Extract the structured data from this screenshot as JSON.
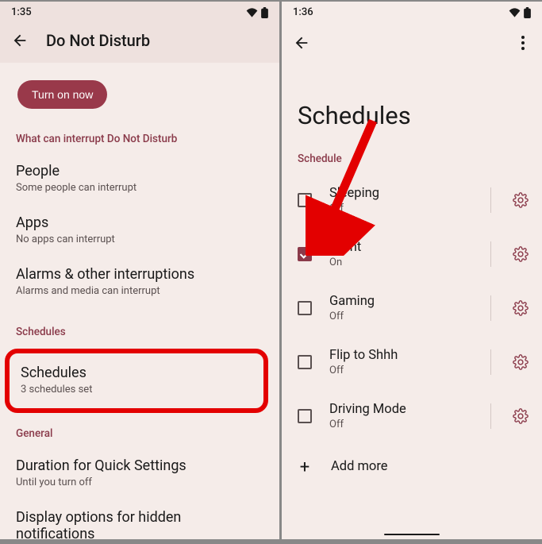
{
  "left": {
    "status_time": "1:35",
    "title": "Do Not Disturb",
    "turn_on_btn": "Turn on now",
    "section_interrupt": "What can interrupt Do Not Disturb",
    "people": {
      "title": "People",
      "sub": "Some people can interrupt"
    },
    "apps": {
      "title": "Apps",
      "sub": "No apps can interrupt"
    },
    "alarms": {
      "title": "Alarms & other interruptions",
      "sub": "Alarms and media can interrupt"
    },
    "section_schedules": "Schedules",
    "schedules": {
      "title": "Schedules",
      "sub": "3 schedules set"
    },
    "section_general": "General",
    "duration": {
      "title": "Duration for Quick Settings",
      "sub": "Until you turn off"
    },
    "display_opts": {
      "title": "Display options for hidden notifications"
    }
  },
  "right": {
    "status_time": "1:36",
    "big_title": "Schedules",
    "section_schedule": "Schedule",
    "items": [
      {
        "title": "Sleeping",
        "sub": "Off",
        "checked": false
      },
      {
        "title": "Event",
        "sub": "On",
        "checked": true
      },
      {
        "title": "Gaming",
        "sub": "Off",
        "checked": false
      },
      {
        "title": "Flip to Shhh",
        "sub": "Off",
        "checked": false
      },
      {
        "title": "Driving Mode",
        "sub": "Off",
        "checked": false
      }
    ],
    "add_more": "Add more"
  }
}
